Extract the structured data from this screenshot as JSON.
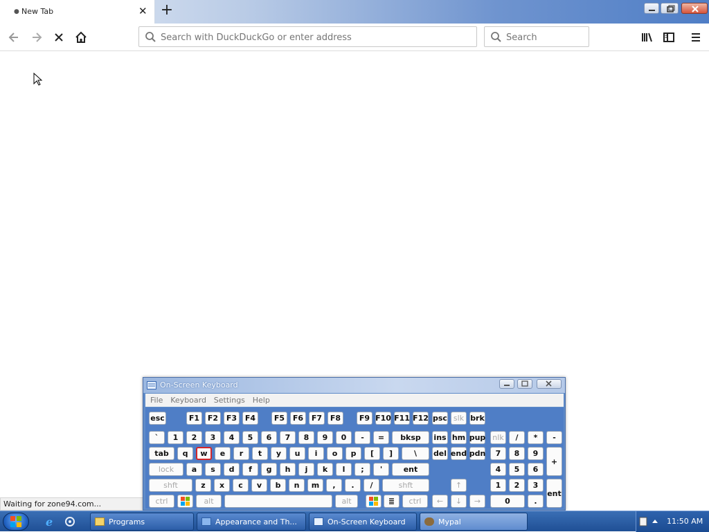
{
  "browser": {
    "tab": {
      "title": "New Tab"
    },
    "url_placeholder": "Search with DuckDuckGo or enter address",
    "search_placeholder": "Search",
    "status_text": "Waiting for zone94.com..."
  },
  "osk": {
    "title": "On-Screen Keyboard",
    "menu": [
      "File",
      "Keyboard",
      "Settings",
      "Help"
    ]
  },
  "taskbar": {
    "items": [
      "Programs",
      "Appearance and Th...",
      "On-Screen Keyboard",
      "Mypal"
    ],
    "time": "11:50 AM"
  },
  "colors": {
    "taskbar": "#2c5ea8",
    "osk_frame": "#4f7ec6",
    "highlight_key": "#d2272a"
  }
}
